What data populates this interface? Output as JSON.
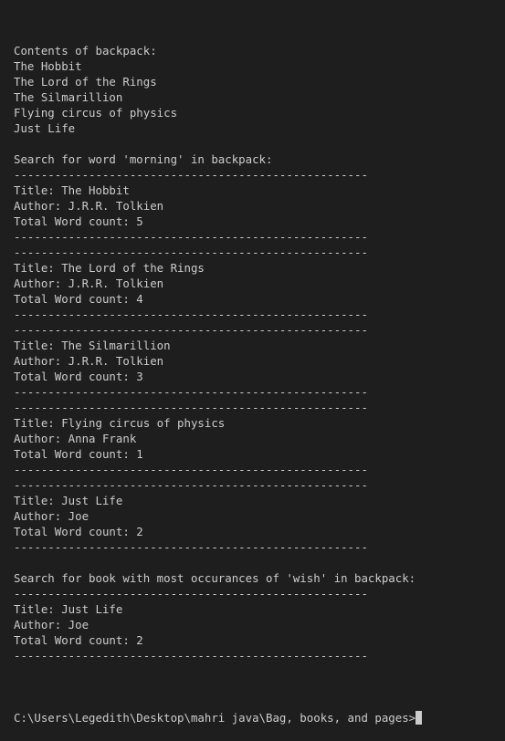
{
  "terminal": {
    "lines": [
      "Contents of backpack:",
      "The Hobbit",
      "The Lord of the Rings",
      "The Silmarillion",
      "Flying circus of physics",
      "Just Life",
      "",
      "Search for word 'morning' in backpack:",
      "----------------------------------------------------",
      "Title: The Hobbit",
      "Author: J.R.R. Tolkien",
      "Total Word count: 5",
      "----------------------------------------------------",
      "----------------------------------------------------",
      "Title: The Lord of the Rings",
      "Author: J.R.R. Tolkien",
      "Total Word count: 4",
      "----------------------------------------------------",
      "----------------------------------------------------",
      "Title: The Silmarillion",
      "Author: J.R.R. Tolkien",
      "Total Word count: 3",
      "----------------------------------------------------",
      "----------------------------------------------------",
      "Title: Flying circus of physics",
      "Author: Anna Frank",
      "Total Word count: 1",
      "----------------------------------------------------",
      "----------------------------------------------------",
      "Title: Just Life",
      "Author: Joe",
      "Total Word count: 2",
      "----------------------------------------------------",
      "",
      "Search for book with most occurances of 'wish' in backpack:",
      "----------------------------------------------------",
      "Title: Just Life",
      "Author: Joe",
      "Total Word count: 2",
      "----------------------------------------------------",
      ""
    ],
    "prompt": "C:\\Users\\Legedith\\Desktop\\mahri java\\Bag, books, and pages>"
  },
  "colors": {
    "background": "#1e1e1e",
    "text": "#cccccc"
  }
}
